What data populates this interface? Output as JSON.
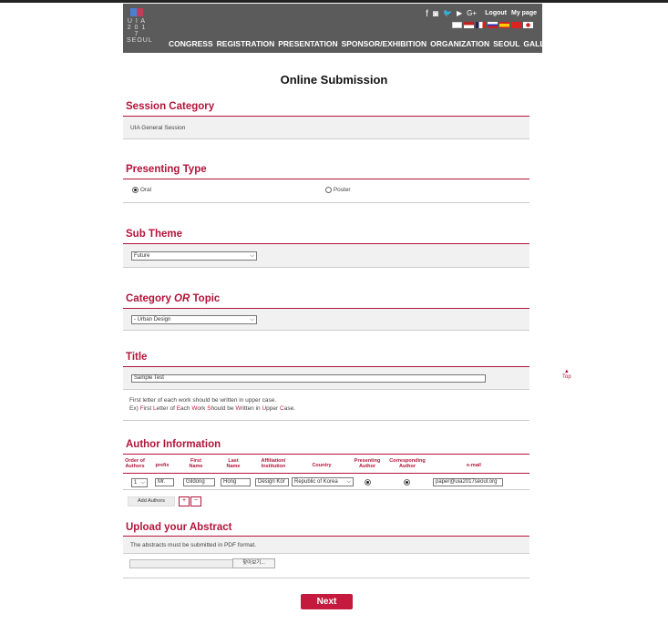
{
  "header": {
    "logo": {
      "line1": "U I A",
      "line2": "2 0 1 7",
      "line3": "SEOUL"
    },
    "social_icons": [
      "facebook-icon",
      "instagram-icon",
      "twitter-icon",
      "youtube-icon",
      "googleplus-icon"
    ],
    "social_glyphs": [
      "f",
      "◙",
      "🐦",
      "▶",
      "G+"
    ],
    "logout": "Logout",
    "mypage": "My page",
    "nav": [
      "CONGRESS",
      "REGISTRATION",
      "PRESENTATION",
      "SPONSOR/EXHIBITION",
      "ORGANIZATION",
      "SEOUL",
      "GALLERY"
    ]
  },
  "page_title": "Online Submission",
  "session_category": {
    "title": "Session Category",
    "value": "UIA General Session"
  },
  "presenting_type": {
    "title": "Presenting Type",
    "options": [
      "Oral",
      "Poster"
    ],
    "selected": "Oral"
  },
  "sub_theme": {
    "title": "Sub Theme",
    "selected": "Future"
  },
  "category_topic": {
    "title_prefix": "Category ",
    "title_em": "OR",
    "title_suffix": " Topic",
    "selected": "- Urban Design"
  },
  "title_section": {
    "title": "Title",
    "value": "Sample Test",
    "note1": "First letter of each work should be written in upper case.",
    "note2_parts": [
      "Ex) ",
      "F",
      "irst ",
      "L",
      "etter of ",
      "E",
      "ach ",
      "W",
      "ork ",
      "S",
      "hould be ",
      "W",
      "ritten in ",
      "U",
      "pper ",
      "C",
      "ase."
    ]
  },
  "authors": {
    "title": "Author Information",
    "headers": [
      "Order of Authors",
      "prefix",
      "First Name",
      "Last Name",
      "Affiliation/ Institution",
      "Country",
      "Presenting Author",
      "Corresponding Author",
      "e-mail"
    ],
    "row": {
      "order": "1",
      "prefix": "Mr.",
      "first": "Gildong",
      "last": "Hong",
      "affiliation": "Design Kor",
      "country": "Republic of Korea",
      "email": "paper@uia2017seoul.org"
    },
    "add_button": "Add Authors",
    "plus": "+",
    "minus": "−"
  },
  "upload": {
    "title": "Upload your Abstract",
    "note": "The abstracts must be submitted in PDF format.",
    "browse": "찾아보기..."
  },
  "next_button": "Next",
  "scroll_top": "Top",
  "colors": {
    "accent": "#b3143a",
    "header_bg": "#5b5b5b",
    "button": "#c41a3e"
  }
}
